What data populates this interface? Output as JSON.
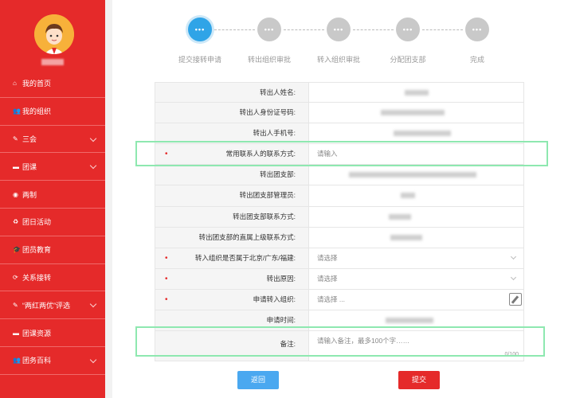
{
  "sidebar": {
    "items": [
      {
        "icon": "home-icon",
        "glyph": "⌂",
        "label": "我的首页",
        "chevron": false
      },
      {
        "icon": "users-icon",
        "glyph": "👥",
        "label": "我的组织",
        "chevron": false
      },
      {
        "icon": "edit-square-icon",
        "glyph": "✎",
        "label": "三会",
        "chevron": true
      },
      {
        "icon": "folder-icon",
        "glyph": "▬",
        "label": "团课",
        "chevron": true
      },
      {
        "icon": "dot-circle-icon",
        "glyph": "◉",
        "label": "两制",
        "chevron": false
      },
      {
        "icon": "recycle-icon",
        "glyph": "♻",
        "label": "团日活动",
        "chevron": false
      },
      {
        "icon": "graduation-cap-icon",
        "glyph": "🎓",
        "label": "团员教育",
        "chevron": false
      },
      {
        "icon": "refresh-icon",
        "glyph": "⟳",
        "label": "关系接转",
        "chevron": false
      },
      {
        "icon": "edit-square-icon",
        "glyph": "✎",
        "label": "“两红两优”评选",
        "chevron": true
      },
      {
        "icon": "folder-icon",
        "glyph": "▬",
        "label": "团课资源",
        "chevron": false
      },
      {
        "icon": "users-icon",
        "glyph": "👥",
        "label": "团务百科",
        "chevron": true
      }
    ]
  },
  "steps": [
    {
      "label": "提交接转申请",
      "dots": "•••",
      "active": true
    },
    {
      "label": "转出组织审批",
      "dots": "•••",
      "active": false
    },
    {
      "label": "转入组织审批",
      "dots": "•••",
      "active": false
    },
    {
      "label": "分配团支部",
      "dots": "•••",
      "active": false
    },
    {
      "label": "完成",
      "dots": "•••",
      "active": false
    }
  ],
  "form": {
    "rows": [
      {
        "label": "转出人姓名:",
        "type": "blurred"
      },
      {
        "label": "转出人身份证号码:",
        "type": "blurred"
      },
      {
        "label": "转出人手机号:",
        "type": "blurred"
      },
      {
        "label": "常用联系人的联系方式:",
        "type": "input",
        "required": true,
        "placeholder": "请输入"
      },
      {
        "label": "转出团支部:",
        "type": "blurred"
      },
      {
        "label": "转出团支部管理员:",
        "type": "blurred"
      },
      {
        "label": "转出团支部联系方式:",
        "type": "blurred"
      },
      {
        "label": "转出团支部的直属上级联系方式:",
        "type": "blurred"
      },
      {
        "label": "转入组织是否属于北京/广东/福建:",
        "type": "select",
        "required": true,
        "placeholder": "请选择"
      },
      {
        "label": "转出原因:",
        "type": "select",
        "required": true,
        "placeholder": "请选择"
      },
      {
        "label": "申请转入组织:",
        "type": "picker",
        "required": true,
        "placeholder": "请选择 ..."
      },
      {
        "label": "申请时间:",
        "type": "blurred"
      },
      {
        "label": "备注:",
        "type": "textarea",
        "placeholder": "请输入备注，最多100个字……",
        "counter": "0/100"
      }
    ]
  },
  "buttons": {
    "back": "返回",
    "submit": "提交"
  }
}
